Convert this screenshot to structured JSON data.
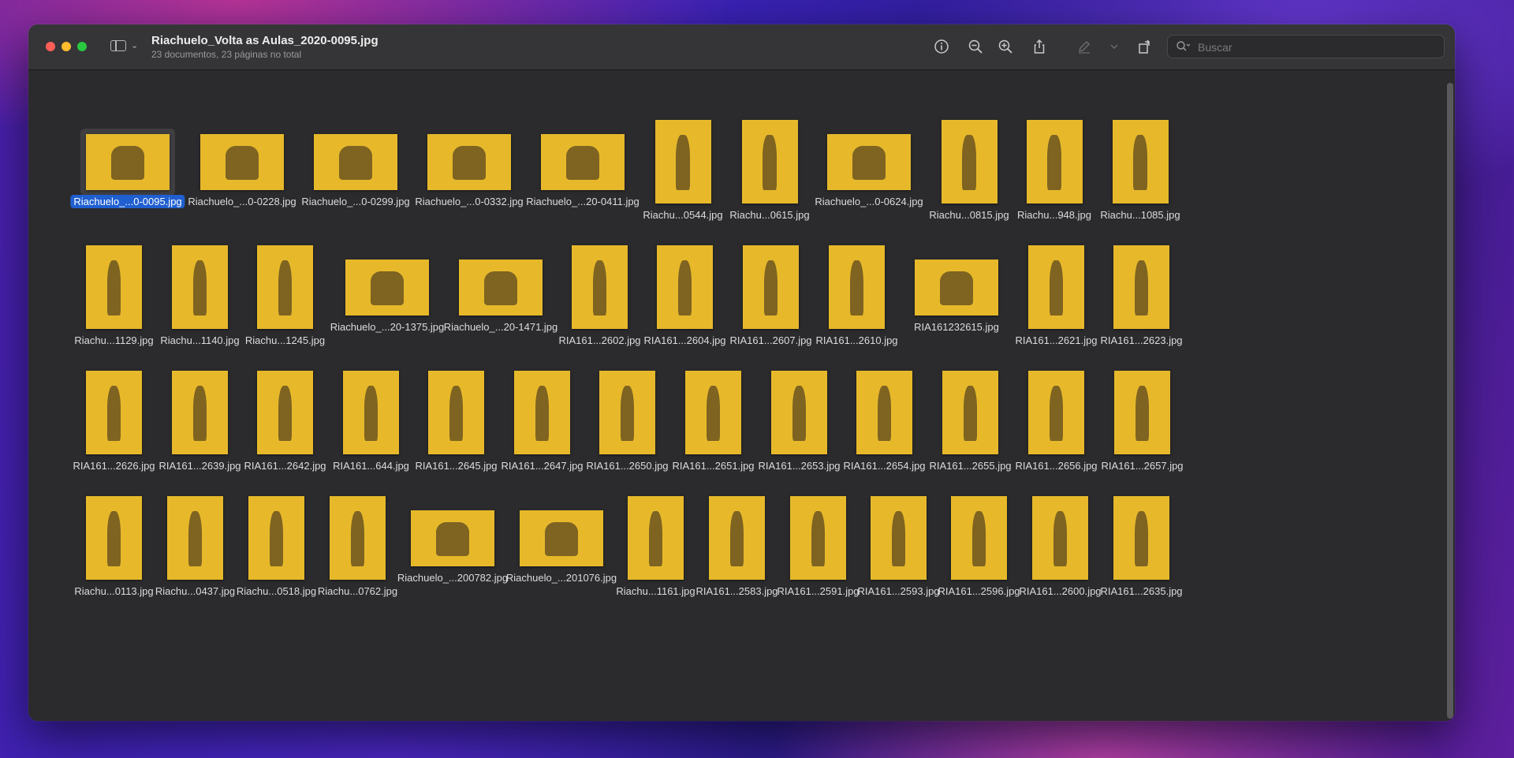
{
  "window": {
    "title": "Riachuelo_Volta as Aulas_2020-0095.jpg",
    "subtitle": "23 documentos, 23 páginas no total"
  },
  "toolbar": {
    "icons": [
      "info-icon",
      "zoom-out-icon",
      "zoom-in-icon",
      "share-icon",
      "markup-pen-icon",
      "markup-chevron-icon",
      "rotate-icon",
      "annotate-icon"
    ]
  },
  "search": {
    "placeholder": "Buscar",
    "value": ""
  },
  "colors": {
    "thumb_bg": "#e7b92a",
    "selection": "#1f5fd0",
    "window_bg": "#2b2b2d"
  },
  "thumbnails": {
    "row1": [
      {
        "label": "Riachuelo_...0-0095.jpg",
        "orientation": "landscape",
        "selected": true
      },
      {
        "label": "Riachuelo_...0-0228.jpg",
        "orientation": "landscape"
      },
      {
        "label": "Riachuelo_...0-0299.jpg",
        "orientation": "landscape"
      },
      {
        "label": "Riachuelo_...0-0332.jpg",
        "orientation": "landscape"
      },
      {
        "label": "Riachuelo_...20-0411.jpg",
        "orientation": "landscape"
      },
      {
        "label": "Riachu...0544.jpg",
        "orientation": "portrait"
      },
      {
        "label": "Riachu...0615.jpg",
        "orientation": "portrait"
      },
      {
        "label": "Riachuelo_...0-0624.jpg",
        "orientation": "landscape"
      },
      {
        "label": "Riachu...0815.jpg",
        "orientation": "portrait"
      },
      {
        "label": "Riachu...948.jpg",
        "orientation": "portrait"
      },
      {
        "label": "Riachu...1085.jpg",
        "orientation": "portrait"
      }
    ],
    "row2": [
      {
        "label": "Riachu...1129.jpg",
        "orientation": "portrait"
      },
      {
        "label": "Riachu...1140.jpg",
        "orientation": "portrait"
      },
      {
        "label": "Riachu...1245.jpg",
        "orientation": "portrait"
      },
      {
        "label": "Riachuelo_...20-1375.jpg",
        "orientation": "landscape"
      },
      {
        "label": "Riachuelo_...20-1471.jpg",
        "orientation": "landscape"
      },
      {
        "label": "RIA161...2602.jpg",
        "orientation": "portrait"
      },
      {
        "label": "RIA161...2604.jpg",
        "orientation": "portrait"
      },
      {
        "label": "RIA161...2607.jpg",
        "orientation": "portrait"
      },
      {
        "label": "RIA161...2610.jpg",
        "orientation": "portrait"
      },
      {
        "label": "RIA161232615.jpg",
        "orientation": "landscape"
      },
      {
        "label": "RIA161...2621.jpg",
        "orientation": "portrait"
      },
      {
        "label": "RIA161...2623.jpg",
        "orientation": "portrait"
      }
    ],
    "row3": [
      {
        "label": "RIA161...2626.jpg",
        "orientation": "portrait"
      },
      {
        "label": "RIA161...2639.jpg",
        "orientation": "portrait"
      },
      {
        "label": "RIA161...2642.jpg",
        "orientation": "portrait"
      },
      {
        "label": "RIA161...644.jpg",
        "orientation": "portrait"
      },
      {
        "label": "RIA161...2645.jpg",
        "orientation": "portrait"
      },
      {
        "label": "RIA161...2647.jpg",
        "orientation": "portrait"
      },
      {
        "label": "RIA161...2650.jpg",
        "orientation": "portrait"
      },
      {
        "label": "RIA161...2651.jpg",
        "orientation": "portrait"
      },
      {
        "label": "RIA161...2653.jpg",
        "orientation": "portrait"
      },
      {
        "label": "RIA161...2654.jpg",
        "orientation": "portrait"
      },
      {
        "label": "RIA161...2655.jpg",
        "orientation": "portrait"
      },
      {
        "label": "RIA161...2656.jpg",
        "orientation": "portrait"
      },
      {
        "label": "RIA161...2657.jpg",
        "orientation": "portrait"
      }
    ],
    "row4": [
      {
        "label": "Riachu...0113.jpg",
        "orientation": "portrait"
      },
      {
        "label": "Riachu...0437.jpg",
        "orientation": "portrait"
      },
      {
        "label": "Riachu...0518.jpg",
        "orientation": "portrait"
      },
      {
        "label": "Riachu...0762.jpg",
        "orientation": "portrait"
      },
      {
        "label": "Riachuelo_...200782.jpg",
        "orientation": "landscape"
      },
      {
        "label": "Riachuelo_...201076.jpg",
        "orientation": "landscape"
      },
      {
        "label": "Riachu...1161.jpg",
        "orientation": "portrait"
      },
      {
        "label": "RIA161...2583.jpg",
        "orientation": "portrait"
      },
      {
        "label": "RIA161...2591.jpg",
        "orientation": "portrait"
      },
      {
        "label": "RIA161...2593.jpg",
        "orientation": "portrait"
      },
      {
        "label": "RIA161...2596.jpg",
        "orientation": "portrait"
      },
      {
        "label": "RIA161...2600.jpg",
        "orientation": "portrait"
      },
      {
        "label": "RIA161...2635.jpg",
        "orientation": "portrait"
      }
    ]
  }
}
